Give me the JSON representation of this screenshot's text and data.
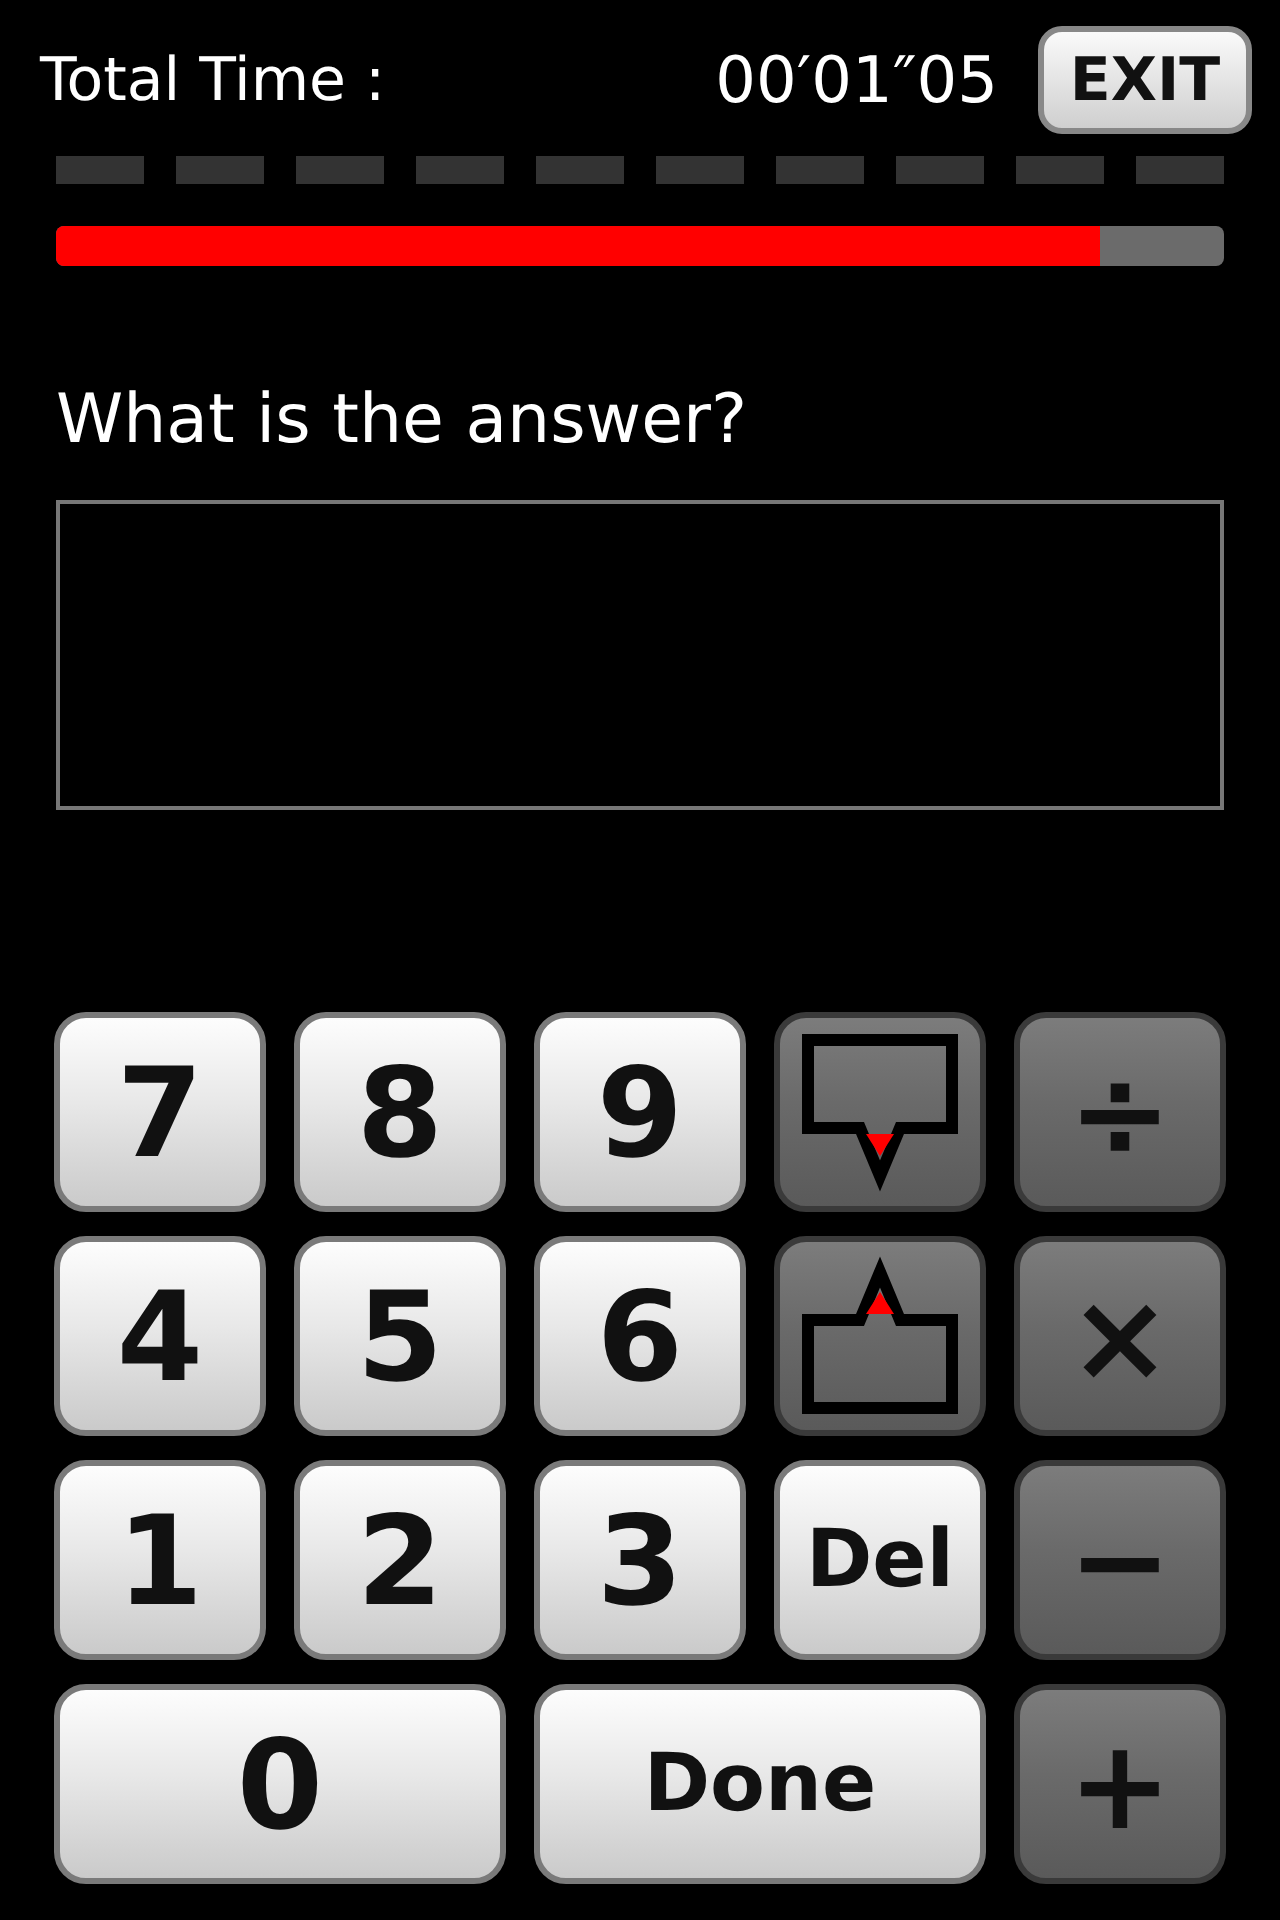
{
  "header": {
    "label": "Total Time :",
    "time": "00′01″05",
    "exit": "EXIT"
  },
  "progress": {
    "level": 0.894
  },
  "question": "What is the answer?",
  "keys": [
    {
      "kind": "digit",
      "label": "7",
      "wide": false
    },
    {
      "kind": "digit",
      "label": "8",
      "wide": false
    },
    {
      "kind": "digit",
      "label": "9",
      "wide": false
    },
    {
      "kind": "move-down",
      "wide": false
    },
    {
      "kind": "operator",
      "label": "÷",
      "wide": false
    },
    {
      "kind": "digit",
      "label": "4",
      "wide": false
    },
    {
      "kind": "digit",
      "label": "5",
      "wide": false
    },
    {
      "kind": "digit",
      "label": "6",
      "wide": false
    },
    {
      "kind": "move-up",
      "wide": false
    },
    {
      "kind": "operator",
      "label": "×",
      "wide": false
    },
    {
      "kind": "digit",
      "label": "1",
      "wide": false
    },
    {
      "kind": "digit",
      "label": "2",
      "wide": false
    },
    {
      "kind": "digit",
      "label": "3",
      "wide": false
    },
    {
      "kind": "word",
      "label": "Del",
      "wide": false
    },
    {
      "kind": "operator",
      "label": "−",
      "wide": false
    },
    {
      "kind": "digit",
      "label": "0",
      "wide": true
    },
    {
      "kind": "word",
      "label": "Done",
      "wide": true
    },
    {
      "kind": "operator",
      "label": "+",
      "wide": false
    }
  ]
}
